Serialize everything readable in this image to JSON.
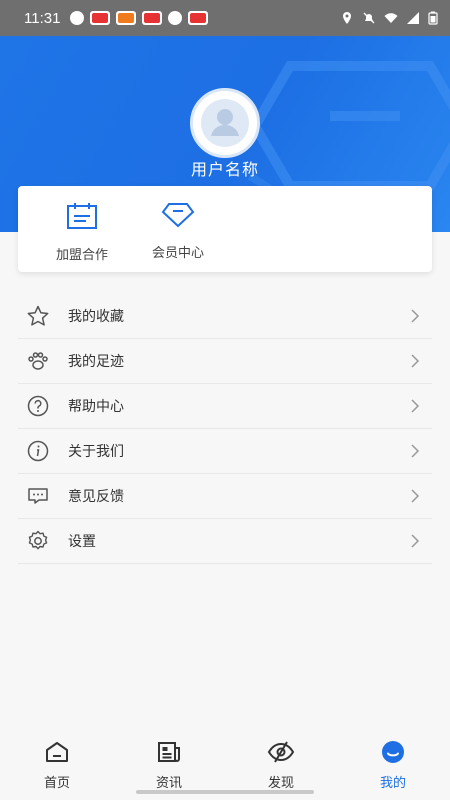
{
  "status_bar": {
    "time": "11:31"
  },
  "profile": {
    "username": "用户名称"
  },
  "quick_actions": [
    {
      "label": "加盟合作",
      "icon": "calendar-icon"
    },
    {
      "label": "会员中心",
      "icon": "diamond-icon"
    }
  ],
  "menu": [
    {
      "label": "我的收藏",
      "icon": "star-icon"
    },
    {
      "label": "我的足迹",
      "icon": "paw-icon"
    },
    {
      "label": "帮助中心",
      "icon": "help-icon"
    },
    {
      "label": "关于我们",
      "icon": "info-icon"
    },
    {
      "label": "意见反馈",
      "icon": "feedback-icon"
    },
    {
      "label": "设置",
      "icon": "settings-icon"
    }
  ],
  "tabs": [
    {
      "label": "首页",
      "icon": "home-icon"
    },
    {
      "label": "资讯",
      "icon": "news-icon"
    },
    {
      "label": "发现",
      "icon": "discover-icon"
    },
    {
      "label": "我的",
      "icon": "profile-icon",
      "active": true
    }
  ],
  "colors": {
    "primary": "#1e6fe3",
    "banner": "#1f74e6"
  }
}
